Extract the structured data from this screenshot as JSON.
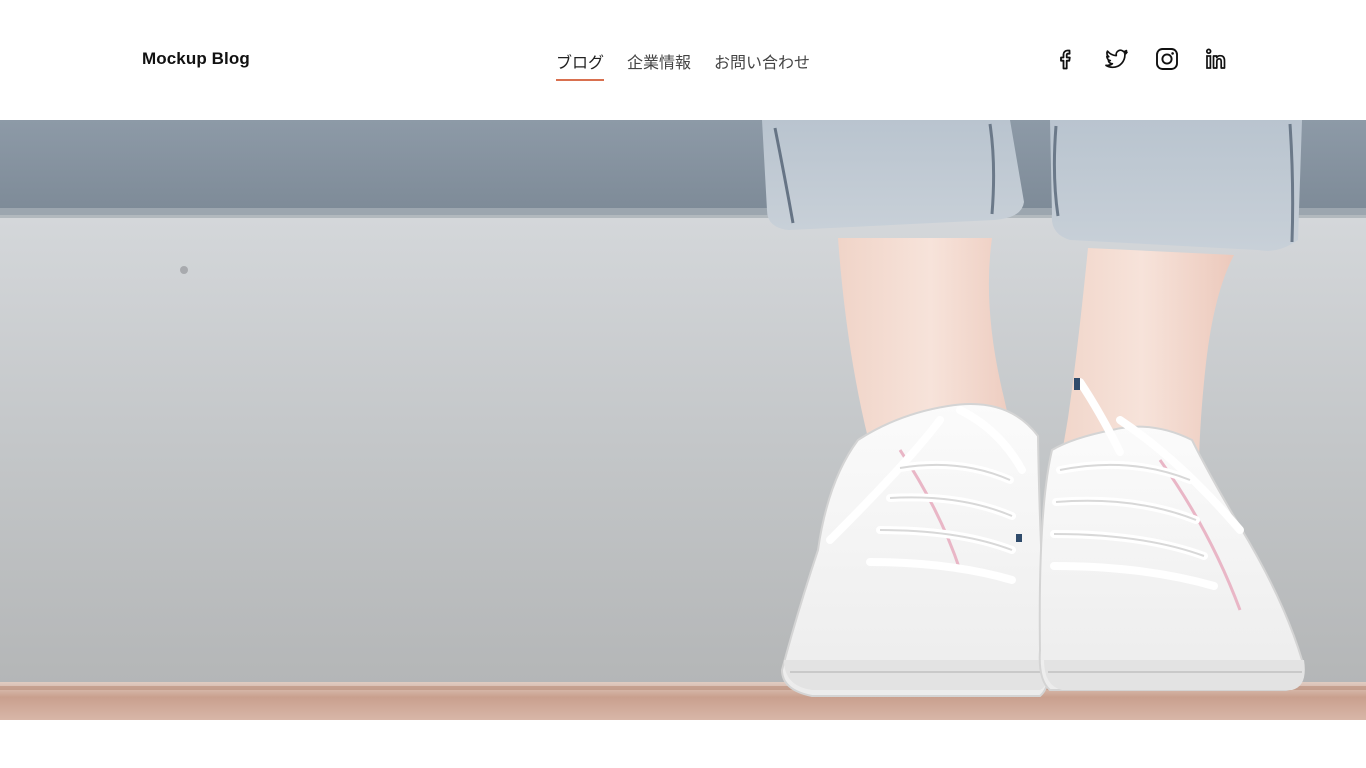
{
  "header": {
    "logo": "Mockup Blog",
    "nav": [
      {
        "label": "ブログ",
        "active": true
      },
      {
        "label": "企業情報",
        "active": false
      },
      {
        "label": "お問い合わせ",
        "active": false
      }
    ],
    "social": [
      {
        "name": "facebook-icon"
      },
      {
        "name": "twitter-icon"
      },
      {
        "name": "instagram-icon"
      },
      {
        "name": "linkedin-icon"
      }
    ]
  },
  "colors": {
    "accent": "#d9704f",
    "text": "#111111"
  },
  "hero": {
    "image": "white-sneakers-on-pavement"
  }
}
